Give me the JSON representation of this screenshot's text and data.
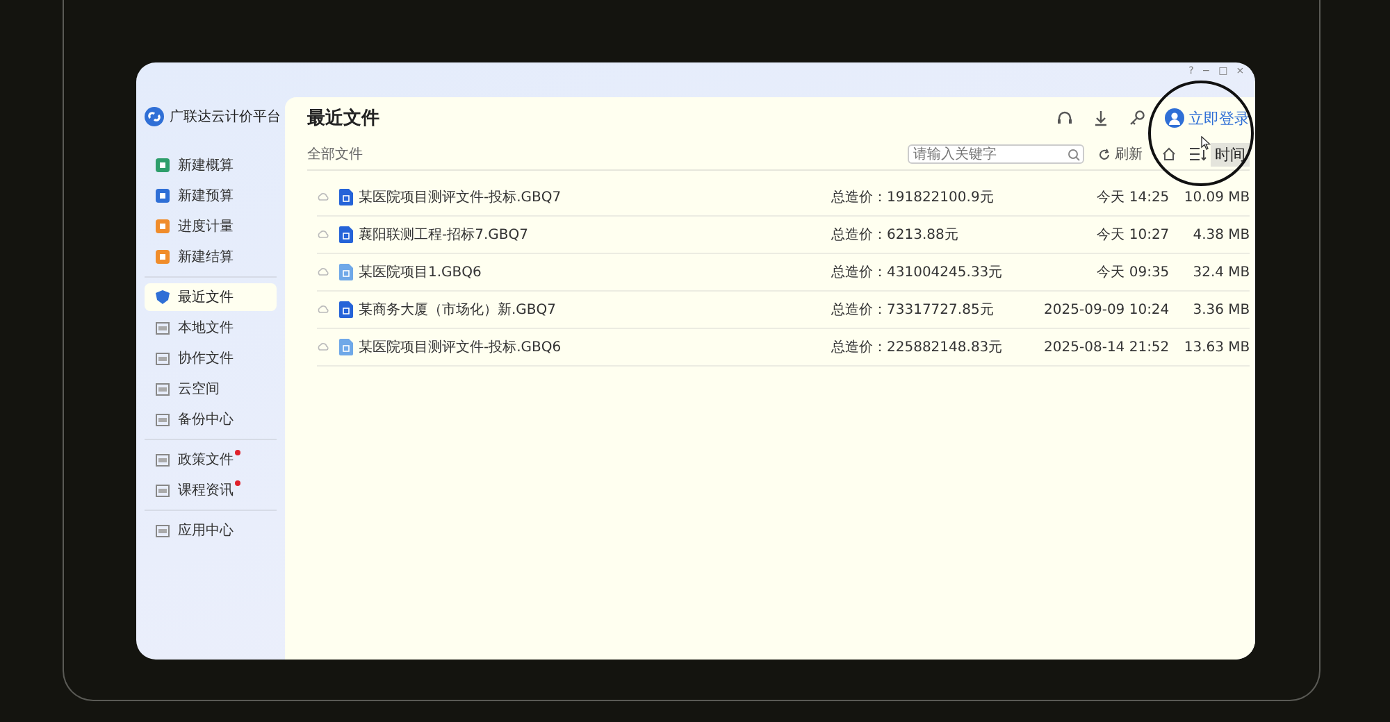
{
  "window": {
    "controls": [
      "?",
      "−",
      "□",
      "×"
    ]
  },
  "sidebar": {
    "app_name": "广联达云计价平台",
    "groups": [
      {
        "items": [
          {
            "label": "新建概算",
            "selected": false,
            "unread": false,
            "color": "#2e9e6b"
          },
          {
            "label": "新建预算",
            "selected": false,
            "unread": false,
            "color": "#2f6fd6"
          },
          {
            "label": "进度计量",
            "selected": false,
            "unread": false,
            "color": "#f08c2a"
          },
          {
            "label": "新建结算",
            "selected": false,
            "unread": false,
            "color": "#f08c2a"
          }
        ]
      },
      {
        "items": [
          {
            "label": "最近文件",
            "selected": true,
            "unread": false
          },
          {
            "label": "本地文件",
            "selected": false,
            "unread": false
          },
          {
            "label": "协作文件",
            "selected": false,
            "unread": false
          },
          {
            "label": "云空间",
            "selected": false,
            "unread": false
          },
          {
            "label": "备份中心",
            "selected": false,
            "unread": false
          }
        ]
      },
      {
        "items": [
          {
            "label": "政策文件",
            "selected": false,
            "unread": true
          },
          {
            "label": "课程资讯",
            "selected": false,
            "unread": true
          }
        ]
      },
      {
        "items": [
          {
            "label": "应用中心",
            "selected": false,
            "unread": false
          }
        ]
      }
    ]
  },
  "header": {
    "title": "最近文件",
    "login": "立即登录"
  },
  "toolbar": {
    "breadcrumb": "全部文件",
    "search": {
      "placeholder": "请输入关键字"
    },
    "refresh": "刷新",
    "sort": "时间"
  },
  "files": [
    {
      "name": "某医院项目测评文件-投标.GBQ7",
      "price": "总造价：191822100.9元",
      "time": "今天 14:25",
      "size": "10.09 MB",
      "color": "#2563d8"
    },
    {
      "name": "襄阳联测工程-招标7.GBQ7",
      "price": "总造价：6213.88元",
      "time": "今天 10:27",
      "size": "4.38 MB",
      "color": "#2563d8"
    },
    {
      "name": "某医院项目1.GBQ6",
      "price": "总造价：431004245.33元",
      "time": "今天 09:35",
      "size": "32.4 MB",
      "color": "#6fa8e8"
    },
    {
      "name": "某商务大厦（市场化）新.GBQ7",
      "price": "总造价：73317727.85元",
      "time": "2025-09-09 10:24",
      "size": "3.36 MB",
      "color": "#2563d8"
    },
    {
      "name": "某医院项目测评文件-投标.GBQ6",
      "price": "总造价：225882148.83元",
      "time": "2025-08-14 21:52",
      "size": "13.63 MB",
      "color": "#6fa8e8"
    }
  ]
}
